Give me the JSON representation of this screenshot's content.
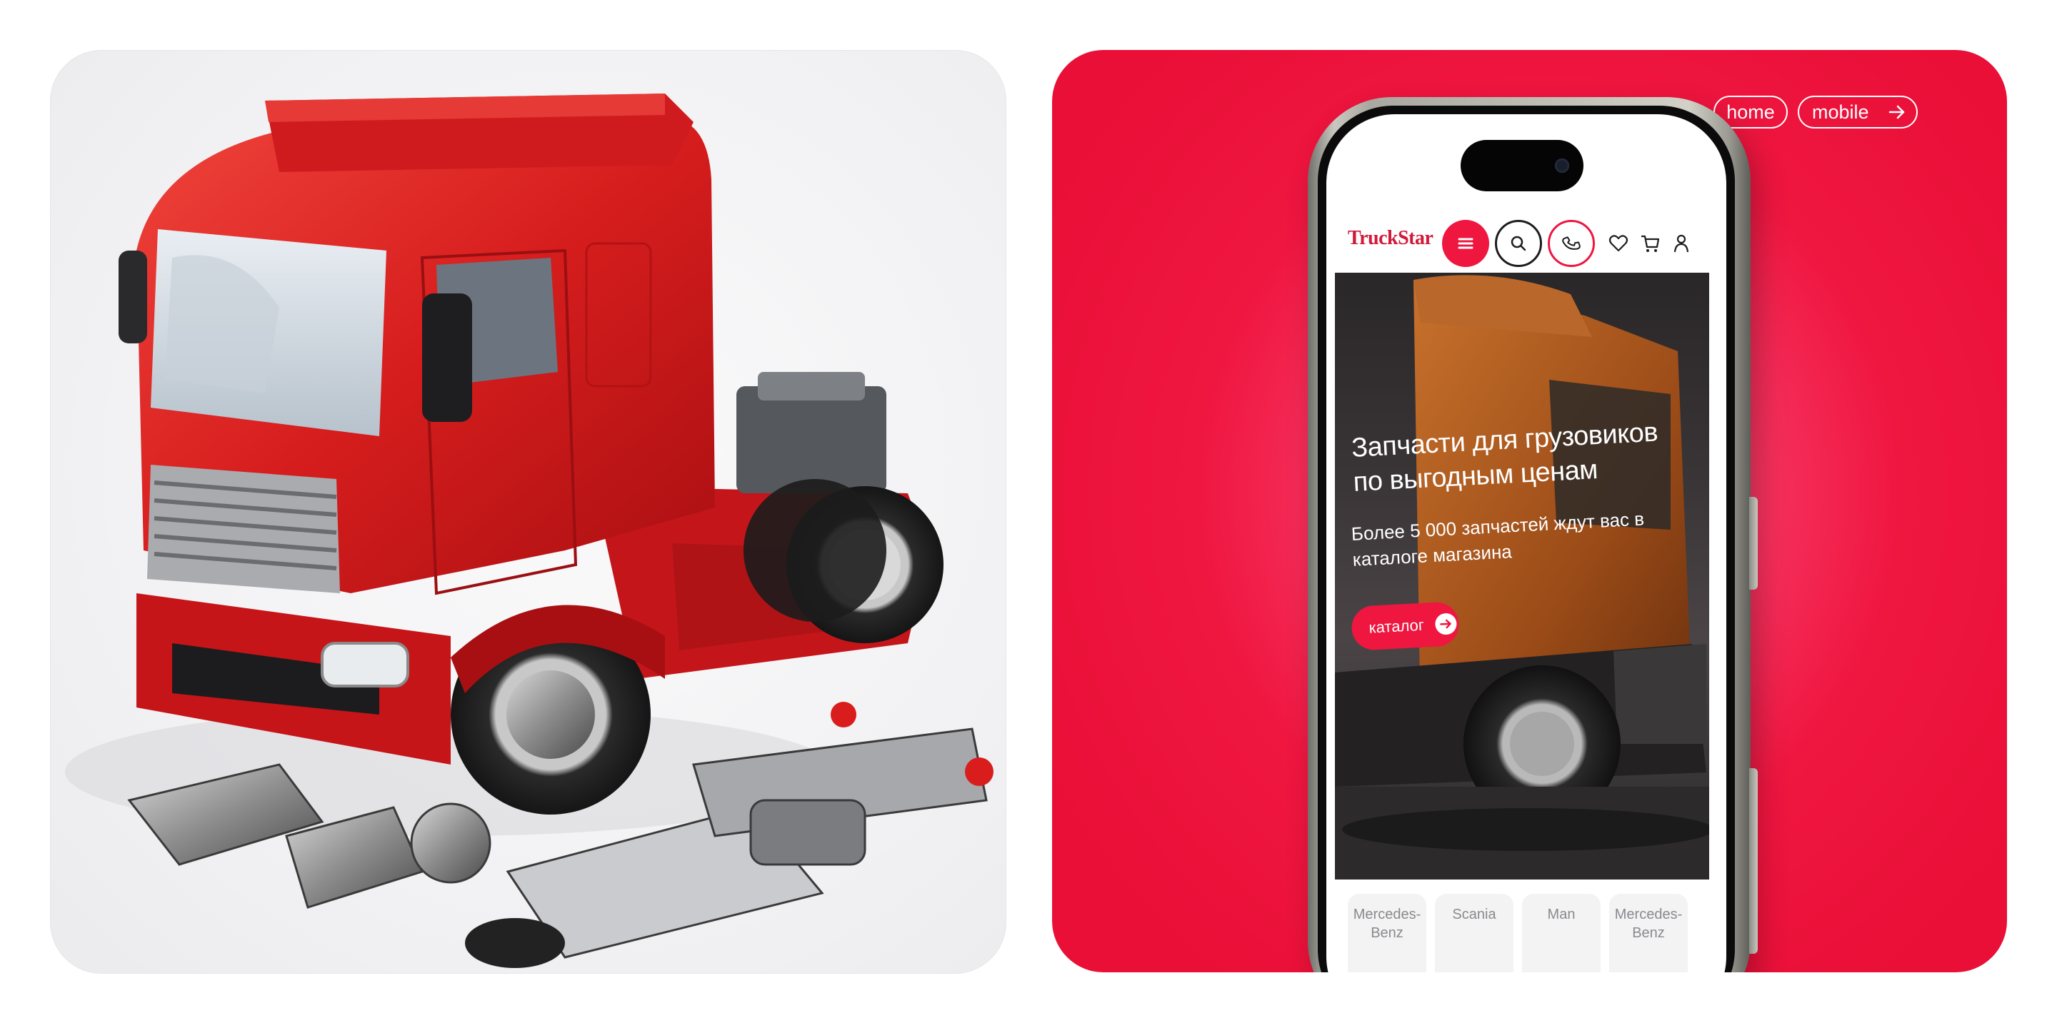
{
  "nav_pills": {
    "home": "home",
    "mobile": "mobile"
  },
  "site": {
    "logo": "TruckStar",
    "hero_title": "Запчасти для грузовиков по выгодным ценам",
    "hero_subtitle": "Более 5 000 запчастей ждут вас в каталоге магазина",
    "catalog_button": "каталог"
  },
  "brands": [
    {
      "label": "Mercedes-Benz"
    },
    {
      "label": "Scania"
    },
    {
      "label": "Man"
    },
    {
      "label": "Mercedes-Benz"
    }
  ],
  "colors": {
    "accent": "#ef1640",
    "logo": "#d11a3a",
    "truck_red": "#e11d1d",
    "hero_truck": "#a5561f"
  },
  "icons": [
    "menu-icon",
    "search-icon",
    "phone-icon",
    "heart-icon",
    "cart-icon",
    "user-icon",
    "arrow-right-icon"
  ]
}
